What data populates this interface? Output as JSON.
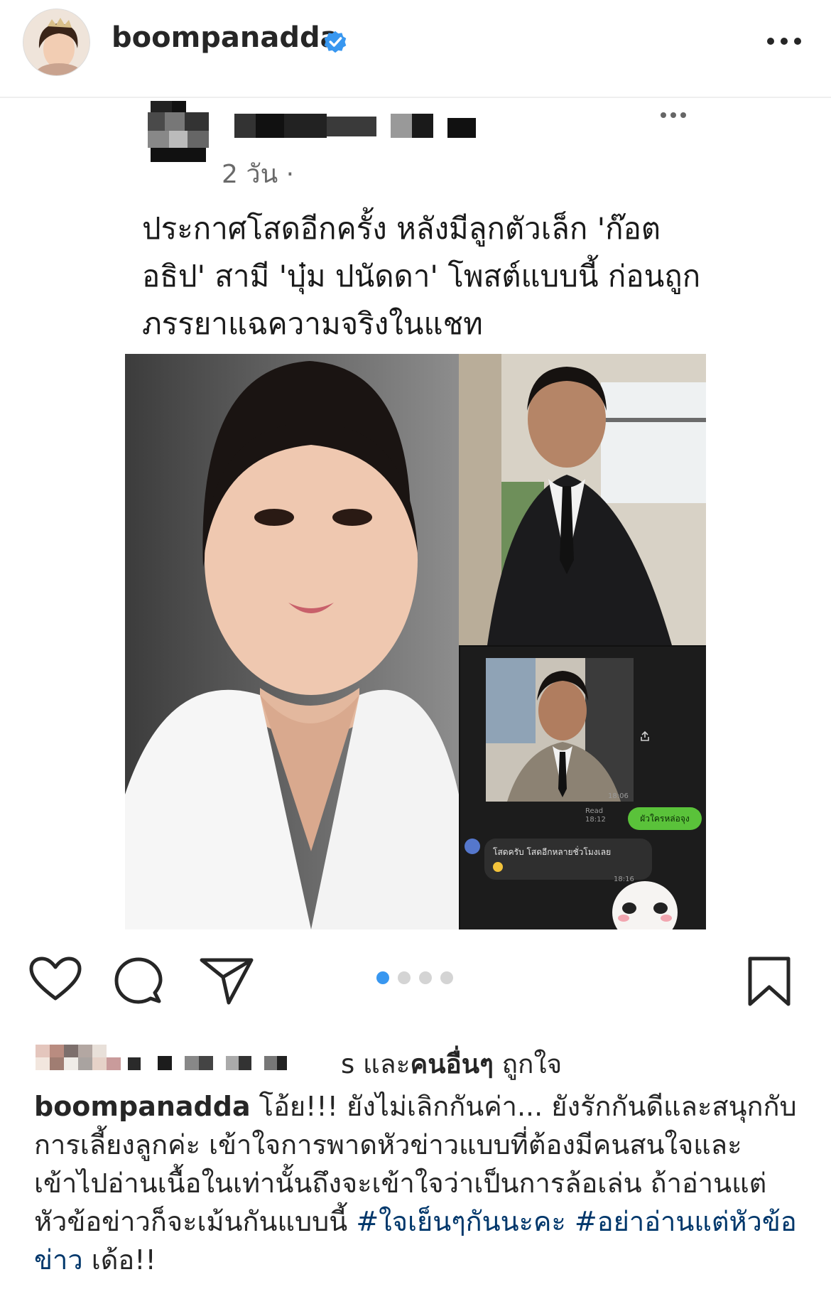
{
  "header": {
    "username": "boompanadda",
    "verified": true,
    "icons": {
      "avatar": "profile-avatar",
      "verified": "verified-badge-icon",
      "more": "more-horizontal-icon"
    }
  },
  "embedded_post": {
    "meta": "2 วัน · ",
    "caption": "ประกาศโสดอีกครั้ง หลังมีลูกตัวเล็ก 'ก๊อต อธิป' สามี 'บุ๋ม ปนัดดา' โพสต์แบบนี้ ก่อนถูกภรรยาแฉความจริงในแชท",
    "chat": {
      "time1": "18:06",
      "read_label": "Read",
      "read_time": "18:12",
      "outgoing": "ผัวใครหล่อจุง",
      "incoming": "โสดครับ โสดอีกหลายชั่วโมงเลย",
      "time2": "18:16"
    }
  },
  "actions": {
    "icons": [
      "heart-icon",
      "comment-icon",
      "share-icon",
      "bookmark-icon"
    ],
    "carousel": {
      "count": 4,
      "active_index": 0
    }
  },
  "likes": {
    "suffix": "s ",
    "connector": "และ",
    "others": "คนอื่นๆ",
    "verb": " ถูกใจ"
  },
  "caption": {
    "username": "boompanadda",
    "text": " โอ้ย!!! ยังไม่เลิกกันค่า... ยังรักกันดีและสนุกกับการเลี้ยงลูกค่ะ  เข้าใจการพาดหัวข่าวแบบที่ต้องมีคนสนใจและเข้าไปอ่านเนื้อในเท่านั้นถึงจะเข้าใจว่าเป็นการล้อเล่น ถ้าอ่านแต่หัวข้อข่าวก็จะเม้นกันแบบนี้ ",
    "hashtag1": "#ใจเย็นๆกันนะคะ",
    "hashtag2": "#อย่าอ่านแต่หัวข้อข่าว",
    "ending": " เด้อ!!"
  },
  "colors": {
    "accent_blue": "#3897f0",
    "hashtag": "#00376b",
    "chat_green": "#5ac23a"
  }
}
